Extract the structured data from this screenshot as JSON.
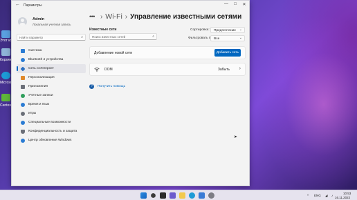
{
  "desktop": {
    "icons": [
      {
        "label": "Этот компьютер",
        "icon": "computer-icon"
      },
      {
        "label": "Корзина",
        "icon": "recycle-bin-icon"
      },
      {
        "label": "Microsoft Edge",
        "icon": "edge-icon"
      },
      {
        "label": "Centos",
        "icon": "app-icon"
      }
    ]
  },
  "window": {
    "title": "Параметры",
    "controls": {
      "minimize": "—",
      "maximize": "□",
      "close": "✕"
    }
  },
  "sidebar": {
    "user": {
      "name": "Admin",
      "type": "Локальная учетная запись"
    },
    "search_placeholder": "Найти параметр",
    "items": [
      {
        "label": "Система",
        "icon": "system-icon",
        "color": "#2b7cd3"
      },
      {
        "label": "Bluetooth и устройства",
        "icon": "bluetooth-icon",
        "color": "#2b7cd3"
      },
      {
        "label": "Сеть и Интернет",
        "icon": "network-icon",
        "color": "#2b6fc0",
        "selected": true
      },
      {
        "label": "Персонализация",
        "icon": "personalization-icon",
        "color": "#e0892b"
      },
      {
        "label": "Приложения",
        "icon": "apps-icon",
        "color": "#6b6f78"
      },
      {
        "label": "Учетные записи",
        "icon": "accounts-icon",
        "color": "#2f9e5b"
      },
      {
        "label": "Время и язык",
        "icon": "time-language-icon",
        "color": "#2b7cd3"
      },
      {
        "label": "Игры",
        "icon": "gaming-icon",
        "color": "#6b6f78"
      },
      {
        "label": "Специальные возможности",
        "icon": "accessibility-icon",
        "color": "#2b7cd3"
      },
      {
        "label": "Конфиденциальность и защита",
        "icon": "privacy-icon",
        "color": "#6b6f78"
      },
      {
        "label": "Центр обновления Windows",
        "icon": "windows-update-icon",
        "color": "#2b7cd3"
      }
    ]
  },
  "main": {
    "breadcrumb": {
      "dots": "•••",
      "separator": "›",
      "parent": "Wi-Fi",
      "current": "Управление известными сетями"
    },
    "known_networks_label": "Известные сети",
    "network_search_placeholder": "Поиск известных сетей",
    "sort": {
      "label": "Сортировка:",
      "value": "Предпочтение"
    },
    "filter": {
      "label": "Фильтровать по:",
      "value": "Все"
    },
    "add_network": {
      "label": "Добавление новой сети",
      "button": "Добавить сеть"
    },
    "networks": [
      {
        "name": "DOM",
        "action": "Забыть"
      }
    ],
    "help_link": "Получить помощь"
  },
  "taskbar": {
    "language": "ENG",
    "time": "10:53",
    "date": "16.11.2022"
  },
  "colors": {
    "accent": "#0067c0",
    "taskbar": "#e6e3ee"
  }
}
